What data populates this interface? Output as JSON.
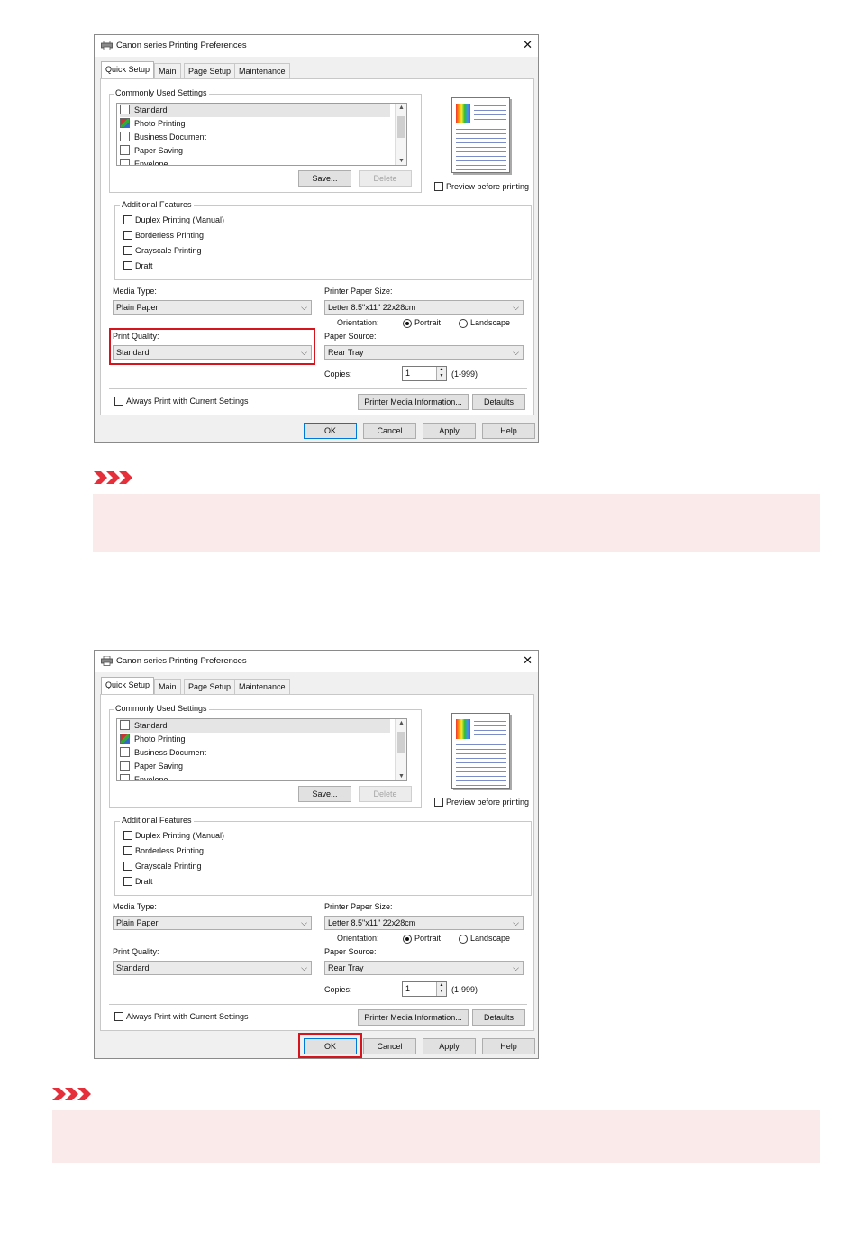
{
  "dialogs": [
    {
      "title": "Canon        series Printing Preferences",
      "close": "✕",
      "tabs": [
        "Quick Setup",
        "Main",
        "Page Setup",
        "Maintenance"
      ],
      "commonly_used": {
        "legend": "Commonly Used Settings",
        "items": [
          "Standard",
          "Photo Printing",
          "Business Document",
          "Paper Saving",
          "Envelope"
        ],
        "selected": "Standard",
        "save": "Save...",
        "delete": "Delete"
      },
      "preview_before_printing": "Preview before printing",
      "additional_features": {
        "legend": "Additional Features",
        "items": [
          "Duplex Printing (Manual)",
          "Borderless Printing",
          "Grayscale Printing",
          "Draft"
        ]
      },
      "media_type": {
        "label": "Media Type:",
        "value": "Plain Paper"
      },
      "printer_paper_size": {
        "label": "Printer Paper Size:",
        "value": "Letter 8.5\"x11\" 22x28cm"
      },
      "orientation": {
        "label": "Orientation:",
        "portrait": "Portrait",
        "landscape": "Landscape",
        "selected": "Portrait"
      },
      "print_quality": {
        "label": "Print Quality:",
        "value": "Standard"
      },
      "paper_source": {
        "label": "Paper Source:",
        "value": "Rear Tray"
      },
      "copies": {
        "label": "Copies:",
        "value": "1",
        "range": "(1-999)"
      },
      "always_print": "Always Print with Current Settings",
      "printer_media_info": "Printer Media Information...",
      "defaults": "Defaults",
      "buttons": {
        "ok": "OK",
        "cancel": "Cancel",
        "apply": "Apply",
        "help": "Help"
      },
      "highlight": "print-quality"
    },
    {
      "title": "Canon        series Printing Preferences",
      "close": "✕",
      "tabs": [
        "Quick Setup",
        "Main",
        "Page Setup",
        "Maintenance"
      ],
      "commonly_used": {
        "legend": "Commonly Used Settings",
        "items": [
          "Standard",
          "Photo Printing",
          "Business Document",
          "Paper Saving",
          "Envelope"
        ],
        "selected": "Standard",
        "save": "Save...",
        "delete": "Delete"
      },
      "preview_before_printing": "Preview before printing",
      "additional_features": {
        "legend": "Additional Features",
        "items": [
          "Duplex Printing (Manual)",
          "Borderless Printing",
          "Grayscale Printing",
          "Draft"
        ]
      },
      "media_type": {
        "label": "Media Type:",
        "value": "Plain Paper"
      },
      "printer_paper_size": {
        "label": "Printer Paper Size:",
        "value": "Letter 8.5\"x11\" 22x28cm"
      },
      "orientation": {
        "label": "Orientation:",
        "portrait": "Portrait",
        "landscape": "Landscape",
        "selected": "Portrait"
      },
      "print_quality": {
        "label": "Print Quality:",
        "value": "Standard"
      },
      "paper_source": {
        "label": "Paper Source:",
        "value": "Rear Tray"
      },
      "copies": {
        "label": "Copies:",
        "value": "1",
        "range": "(1-999)"
      },
      "always_print": "Always Print with Current Settings",
      "printer_media_info": "Printer Media Information...",
      "defaults": "Defaults",
      "buttons": {
        "ok": "OK",
        "cancel": "Cancel",
        "apply": "Apply",
        "help": "Help"
      },
      "highlight": "ok-button"
    }
  ],
  "colors": {
    "highlight": "#d6141e",
    "note_icon": "#e5303b",
    "note_box": "#fbeaea",
    "default_button_border": "#0078d7"
  }
}
